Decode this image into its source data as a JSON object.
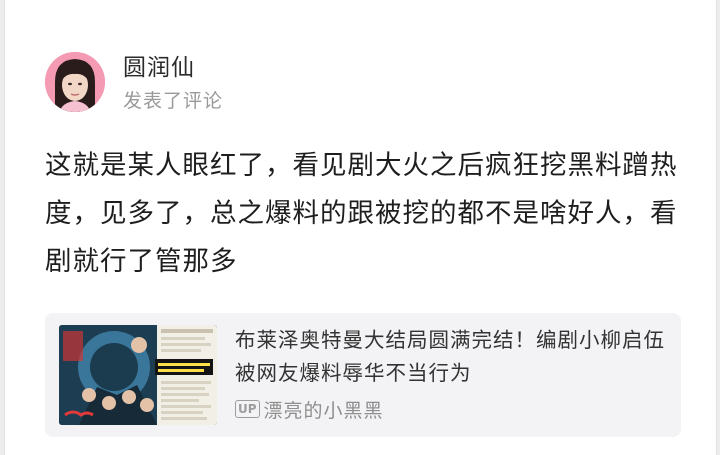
{
  "post": {
    "username": "圆润仙",
    "action": "发表了评论",
    "content": "这就是某人眼红了，看见剧大火之后疯狂挖黑料蹭热度，见多了，总之爆料的跟被挖的都不是啥好人，看剧就行了管那多"
  },
  "share": {
    "title": "布莱泽奥特曼大结局圆满完结！编剧小柳启伍被网友爆料辱华不当行为",
    "badge": "UP",
    "source": "漂亮的小黑黑"
  }
}
